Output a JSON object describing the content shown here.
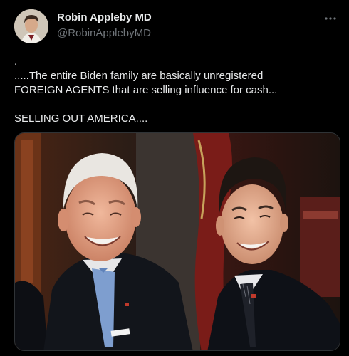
{
  "tweet": {
    "author": {
      "display_name": "Robin Appleby MD",
      "handle": "@RobinApplebyMD"
    },
    "more_icon": "more-horizontal-icon",
    "text_lines": [
      ".",
      ".....The entire Biden family are basically unregistered",
      "FOREIGN AGENTS  that are selling influence for cash...",
      "",
      "SELLING OUT AMERICA...."
    ],
    "media": {
      "kind": "photo"
    }
  },
  "colors": {
    "background": "#000000",
    "text_primary": "#e7e9ea",
    "text_secondary": "#71767b",
    "border": "#2f3336"
  }
}
